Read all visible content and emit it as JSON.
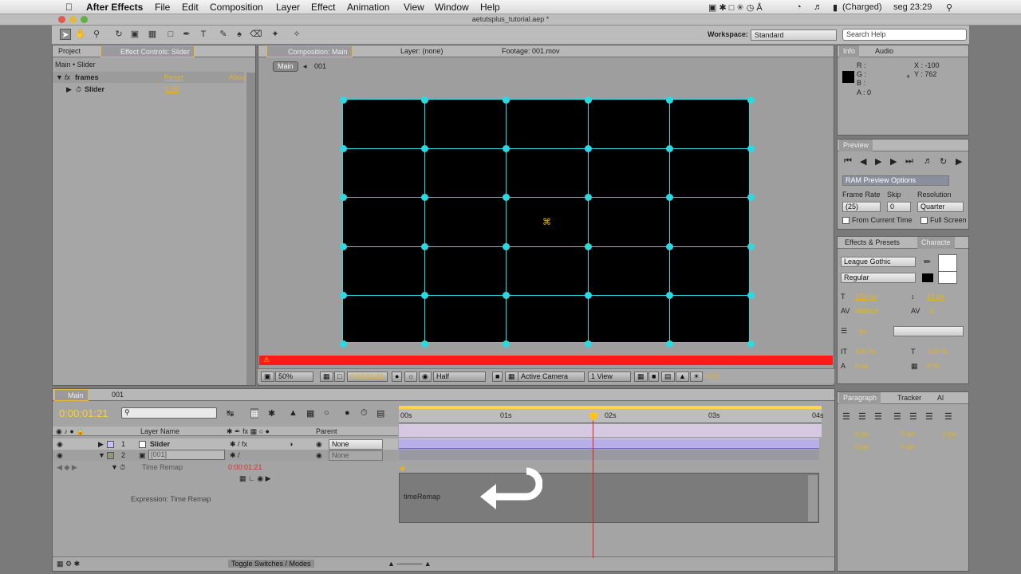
{
  "menubar": {
    "apple": "",
    "app": "After Effects",
    "items": [
      "File",
      "Edit",
      "Composition",
      "Layer",
      "Effect",
      "Animation",
      "View",
      "Window",
      "Help"
    ],
    "battery": "(Charged)",
    "clock": "seg 23:29"
  },
  "title": "aetutsplus_tutorial.aep *",
  "workspace": {
    "label": "Workspace:",
    "value": "Standard",
    "search_placeholder": "Search Help"
  },
  "left_panel": {
    "tab_project": "Project",
    "tab_effect_controls": "Effect Controls: Slider",
    "breadcrumb": "Main • Slider",
    "effect_name": "frames",
    "reset": "Reset",
    "about": "Abou",
    "param_name": "Slider",
    "param_value": "0,00"
  },
  "viewer": {
    "tab_comp": "Composition: Main",
    "tab_layer": "Layer: (none)",
    "tab_footage": "Footage: 001.mov",
    "nav_current": "Main",
    "nav_next": "001"
  },
  "viewer_controls": {
    "zoom": "50%",
    "timecode": "0:00:01:21",
    "resolution": "Half",
    "camera": "Active Camera",
    "views": "1 View",
    "exposure": "+0,0"
  },
  "info_panel": {
    "tab_info": "Info",
    "tab_audio": "Audio",
    "r": "R :",
    "g": "G :",
    "b": "B :",
    "a": "A : 0",
    "x": "X : -100",
    "y": "Y : 762"
  },
  "preview_panel": {
    "tab": "Preview",
    "ram_options": "RAM Preview Options",
    "frame_rate_label": "Frame Rate",
    "skip_label": "Skip",
    "resolution_label": "Resolution",
    "frame_rate": "(25)",
    "skip": "0",
    "resolution": "Quarter",
    "from_current": "From Current Time",
    "full_screen": "Full Screen"
  },
  "character_panel": {
    "tab_effects": "Effects & Presets",
    "tab_character": "Characte",
    "font": "League Gothic",
    "style": "Regular",
    "size": "159 px",
    "leading": "41 px",
    "kerning": "Metrics",
    "tracking": "-3",
    "stroke": "- px",
    "vscale": "100 %",
    "hscale": "100 %",
    "baseline": "0 px",
    "tsume": "0 %"
  },
  "paragraph_panel": {
    "tab_paragraph": "Paragraph",
    "tab_tracker": "Tracker",
    "tab_al": "Al",
    "indent1": "0 px",
    "indent2": "0 px",
    "indent3": "0 px",
    "space1": "0 px",
    "space2": "0 px"
  },
  "timeline": {
    "tab_main": "Main",
    "tab_001": "001",
    "timecode": "0:00:01:21",
    "col_layer_name": "Layer Name",
    "col_parent": "Parent",
    "layers": [
      {
        "num": "1",
        "name": "Slider",
        "parent": "None"
      },
      {
        "num": "2",
        "name": "[001]",
        "parent": "None"
      }
    ],
    "time_remap": "Time Remap",
    "time_remap_value": "0:00:01:21",
    "expression_label": "Expression: Time Remap",
    "expression_text": "timeRemap",
    "ticks": [
      "00s",
      "01s",
      "02s",
      "03s",
      "04s"
    ],
    "toggle": "Toggle Switches / Modes"
  },
  "colors": {
    "cyan": "#2ed8e0",
    "timecode": "#ffcf3a",
    "warning": "#ff1a1a",
    "playhead": "#e02020"
  }
}
